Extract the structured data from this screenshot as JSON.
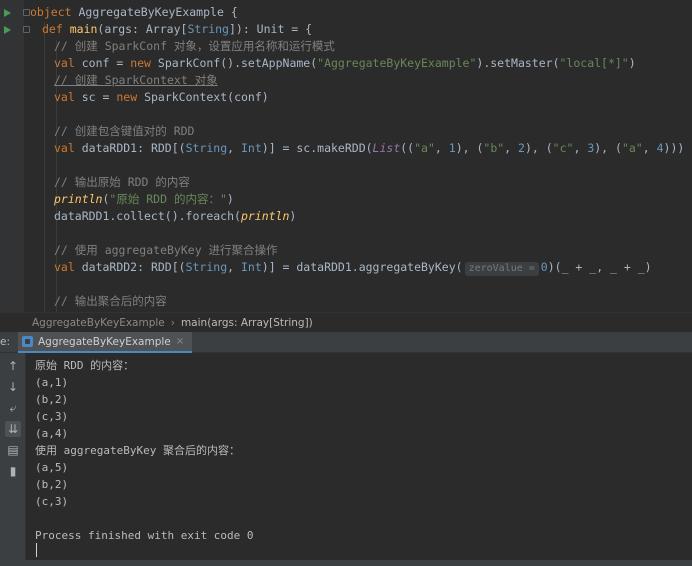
{
  "editor": {
    "lines": {
      "l0": [
        "object",
        "AggregateByKeyExample",
        "{"
      ],
      "l1": [
        "def",
        "main",
        "(args: Array[",
        "String",
        "]): Unit = {"
      ],
      "l2": "// 创建 SparkConf 对象，设置应用名称和运行模式",
      "l3": [
        "val",
        "conf = ",
        "new",
        "SparkConf().setAppName(",
        "\"AggregateByKeyExample\"",
        ").setMaster(",
        "\"local[*]\"",
        ")"
      ],
      "l4": "// 创建 SparkContext 对象",
      "l5": [
        "val",
        "sc = ",
        "new",
        "SparkContext(conf)"
      ],
      "l6": "// 创建包含键值对的 RDD",
      "l7": [
        "val",
        "dataRDD1: RDD[(",
        "String",
        ", ",
        "Int",
        ")] = sc.makeRDD(",
        "List",
        "((",
        "\"a\"",
        ", ",
        "1",
        "), (",
        "\"b\"",
        ", ",
        "2",
        "), (",
        "\"c\"",
        ", ",
        "3",
        "), (",
        "\"a\"",
        ", ",
        "4",
        ")))"
      ],
      "l8": "// 输出原始 RDD 的内容",
      "l9": [
        "println",
        "(",
        "\"原始 RDD 的内容：\"",
        ")"
      ],
      "l10": [
        "dataRDD1.collect().foreach(",
        "println",
        ")"
      ],
      "l11": "// 使用 aggregateByKey 进行聚合操作",
      "l12": [
        "val",
        "dataRDD2: RDD[(",
        "String",
        ", ",
        "Int",
        ")] = dataRDD1.aggregateByKey(",
        "zeroValue =",
        "0",
        ")(_ + _, _ + _)"
      ],
      "l13": "// 输出聚合后的内容"
    }
  },
  "breadcrumb": {
    "object": "AggregateByKeyExample",
    "method": "main(args: Array[String])"
  },
  "run": {
    "label": "e:",
    "tab": "AggregateByKeyExample",
    "close": "×"
  },
  "console": {
    "lines": [
      "原始 RDD 的内容：",
      "(a,1)",
      "(b,2)",
      "(c,3)",
      "(a,4)",
      "使用 aggregateByKey 聚合后的内容：",
      "(a,5)",
      "(b,2)",
      "(c,3)",
      "",
      "Process finished with exit code 0"
    ]
  },
  "tools": [
    "up-icon",
    "down-icon",
    "wrap-icon",
    "scroll-to-end-icon",
    "print-icon",
    "trash-icon"
  ],
  "colors": {
    "keyword": "#cc7832",
    "function": "#ffc66d",
    "string": "#6a8759",
    "number": "#6897bb",
    "comment": "#808080",
    "accent": "#4a88c7"
  }
}
